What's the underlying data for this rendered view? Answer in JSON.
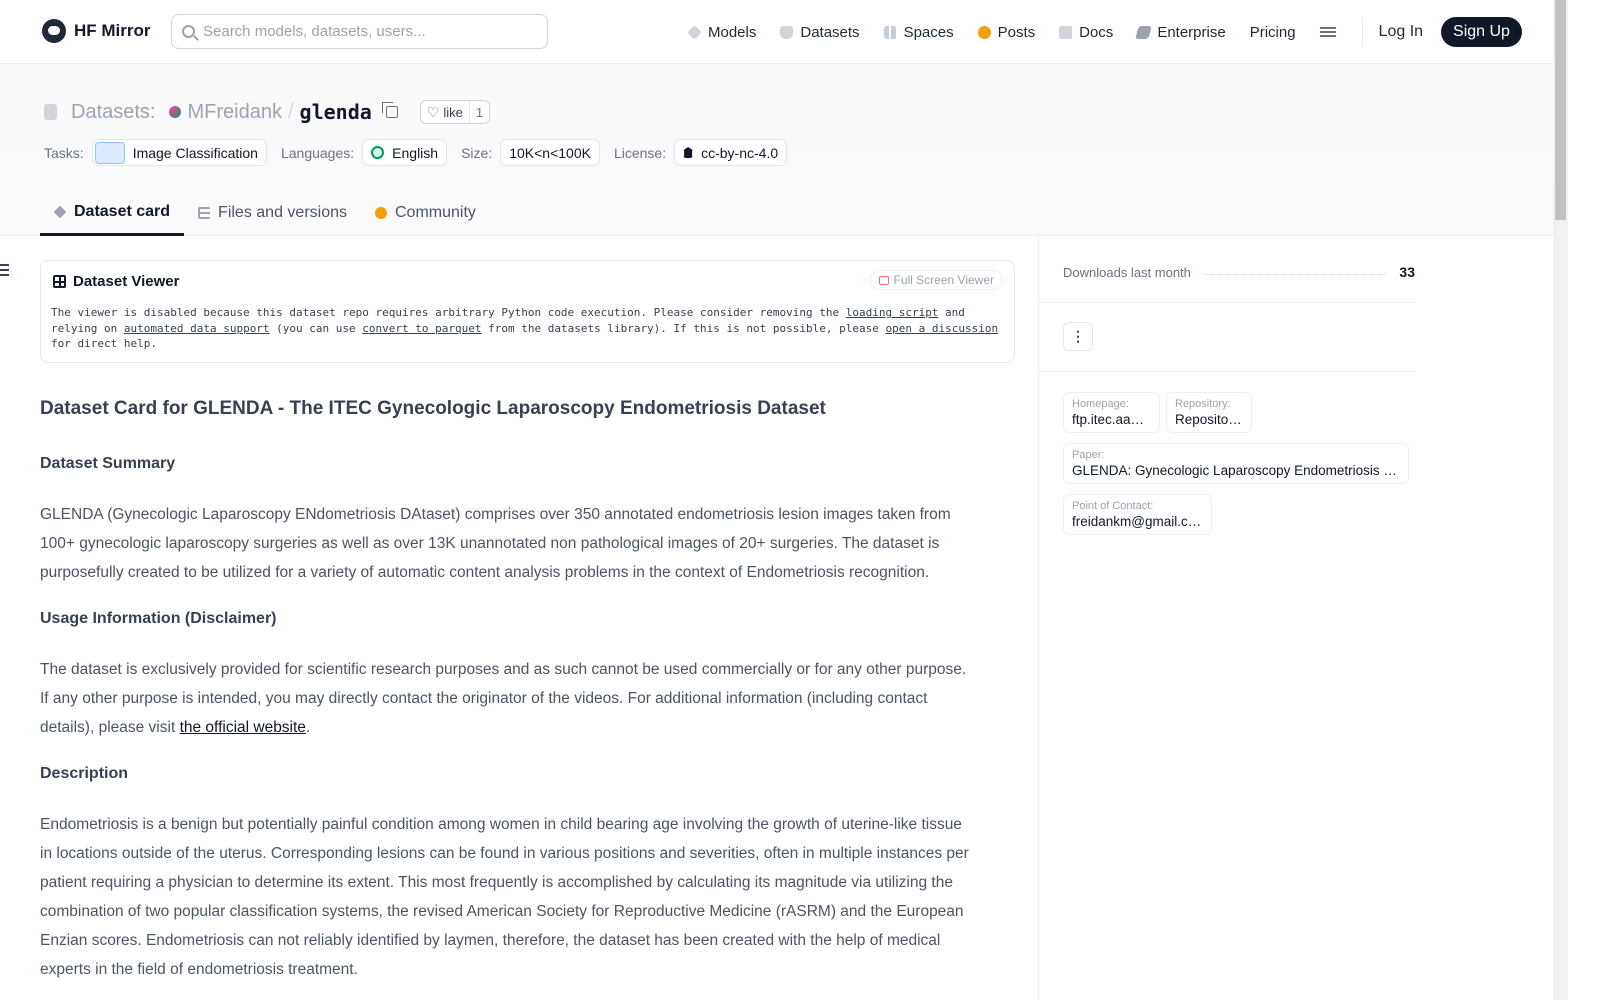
{
  "nav": {
    "brand": "HF Mirror",
    "search_placeholder": "Search models, datasets, users...",
    "links": [
      {
        "label": "Models",
        "icon": "models-icon"
      },
      {
        "label": "Datasets",
        "icon": "datasets-icon"
      },
      {
        "label": "Spaces",
        "icon": "spaces-icon"
      },
      {
        "label": "Posts",
        "icon": "posts-icon"
      },
      {
        "label": "Docs",
        "icon": "docs-icon"
      },
      {
        "label": "Enterprise",
        "icon": "enterprise-icon"
      },
      {
        "label": "Pricing",
        "icon": ""
      }
    ],
    "login": "Log In",
    "signup": "Sign Up"
  },
  "repo": {
    "type_label": "Datasets:",
    "owner": "MFreidank",
    "separator": "/",
    "name": "glenda",
    "like_label": "like",
    "like_count": "1"
  },
  "tags": {
    "tasks_label": "Tasks:",
    "task": "Image Classification",
    "languages_label": "Languages:",
    "language": "English",
    "size_label": "Size:",
    "size": "10K<n<100K",
    "license_label": "License:",
    "license": "cc-by-nc-4.0"
  },
  "tabs": [
    {
      "label": "Dataset card",
      "active": true
    },
    {
      "label": "Files and versions",
      "active": false
    },
    {
      "label": "Community",
      "active": false
    }
  ],
  "viewer": {
    "title": "Dataset Viewer",
    "fullscreen": "Full Screen Viewer",
    "msg_1": "The viewer is disabled because this dataset repo requires arbitrary Python code execution. Please consider removing the ",
    "link_loading": "loading script",
    "msg_2": " and relying on ",
    "link_automated": "automated data support",
    "msg_3": " (you can use ",
    "link_parquet": "convert to parquet",
    "msg_4": " from the datasets library). If this is not possible, please ",
    "link_discussion": "open a discussion",
    "msg_5": " for direct help."
  },
  "card": {
    "title": "Dataset Card for GLENDA - The ITEC Gynecologic Laparoscopy Endometriosis Dataset",
    "summary_heading": "Dataset Summary",
    "summary": "GLENDA (Gynecologic Laparoscopy ENdometriosis DAtaset) comprises over 350 annotated endometriosis lesion images taken from 100+ gynecologic laparoscopy surgeries as well as over 13K unannotated non pathological images of 20+ surgeries. The dataset is purposefully created to be utilized for a variety of automatic content analysis problems in the context of Endometriosis recognition.",
    "usage_heading": "Usage Information (Disclaimer)",
    "usage_text": "The dataset is exclusively provided for scientific research purposes and as such cannot be used commercially or for any other purpose. If any other purpose is intended, you may directly contact the originator of the videos. For additional information (including contact details), please visit ",
    "usage_link": "the official website",
    "usage_end": ".",
    "description_heading": "Description",
    "description": "Endometriosis is a benign but potentially painful condition among women in child bearing age involving the growth of uterine-like tissue in locations outside of the uterus. Corresponding lesions can be found in various positions and severities, often in multiple instances per patient requiring a physician to determine its extent. This most frequently is accomplished by calculating its magnitude via utilizing the combination of two popular classification systems, the revised American Society for Reproductive Medicine (rASRM) and the European Enzian scores. Endometriosis can not reliably identified by laymen, therefore, the dataset has been created with the help of medical experts in the field of endometriosis treatment."
  },
  "sidebar": {
    "downloads_label": "Downloads last month",
    "downloads_count": "33",
    "homepage_label": "Homepage:",
    "homepage": "ftp.itec.aau.at",
    "repository_label": "Repository:",
    "repository": "Repository:",
    "paper_label": "Paper:",
    "paper": "GLENDA: Gynecologic Laparoscopy Endometriosis Dataset",
    "contact_label": "Point of Contact:",
    "contact": "freidankm@gmail.com"
  }
}
